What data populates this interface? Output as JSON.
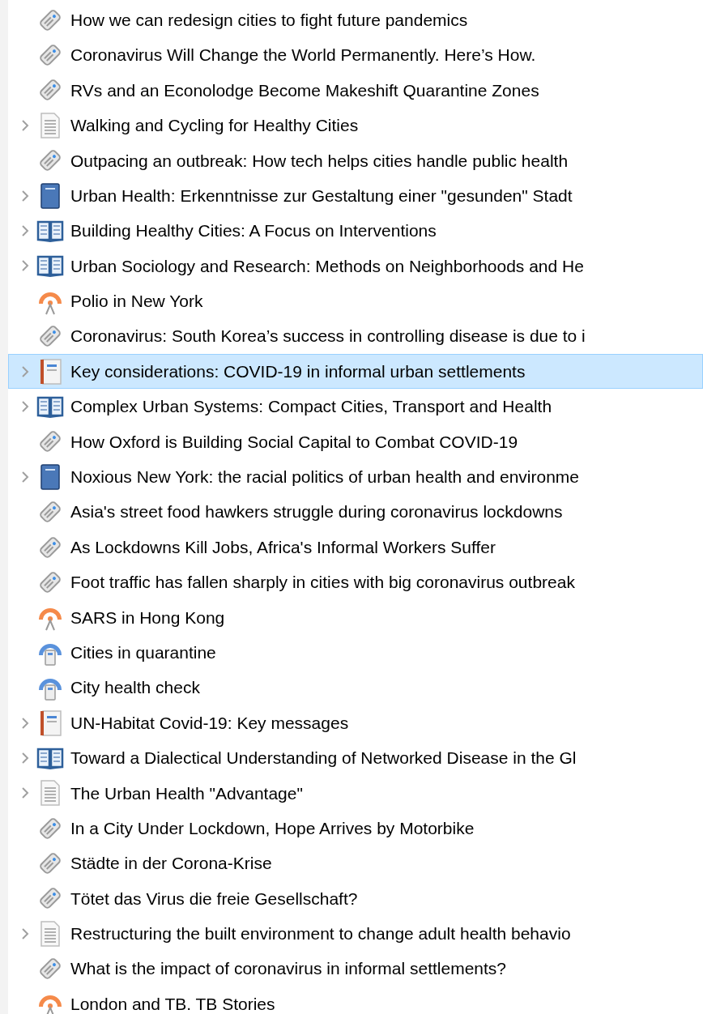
{
  "items": [
    {
      "kind": "webpage",
      "title": "How we can redesign cities to fight future pandemics",
      "expandable": false,
      "selected": false
    },
    {
      "kind": "webpage",
      "title": "Coronavirus Will Change the World Permanently. Here’s How.",
      "expandable": false,
      "selected": false
    },
    {
      "kind": "webpage",
      "title": "RVs and an Econolodge Become Makeshift Quarantine Zones",
      "expandable": false,
      "selected": false
    },
    {
      "kind": "document",
      "title": "Walking and Cycling for Healthy Cities",
      "expandable": true,
      "selected": false
    },
    {
      "kind": "webpage",
      "title": "Outpacing an outbreak: How tech helps cities handle public health",
      "expandable": false,
      "selected": false
    },
    {
      "kind": "book",
      "title": "Urban Health: Erkenntnisse zur Gestaltung einer \"gesunden\" Stadt",
      "expandable": true,
      "selected": false
    },
    {
      "kind": "section",
      "title": "Building Healthy Cities: A Focus on Interventions",
      "expandable": true,
      "selected": false
    },
    {
      "kind": "section",
      "title": "Urban Sociology and Research: Methods on Neighborhoods and He",
      "expandable": true,
      "selected": false
    },
    {
      "kind": "podcast",
      "title": "Polio in New York",
      "expandable": false,
      "selected": false
    },
    {
      "kind": "webpage",
      "title": "Coronavirus: South Korea’s success in controlling disease is due to i",
      "expandable": false,
      "selected": false
    },
    {
      "kind": "report",
      "title": "Key considerations: COVID-19 in informal urban settlements",
      "expandable": true,
      "selected": true
    },
    {
      "kind": "section",
      "title": "Complex Urban Systems: Compact Cities, Transport and Health",
      "expandable": true,
      "selected": false
    },
    {
      "kind": "webpage",
      "title": "How Oxford is Building Social Capital to Combat COVID-19",
      "expandable": false,
      "selected": false
    },
    {
      "kind": "book",
      "title": "Noxious New York: the racial politics of urban health and environme",
      "expandable": true,
      "selected": false
    },
    {
      "kind": "webpage",
      "title": "Asia's street food hawkers struggle during coronavirus lockdowns",
      "expandable": false,
      "selected": false
    },
    {
      "kind": "webpage",
      "title": "As Lockdowns Kill Jobs, Africa's Informal Workers Suffer",
      "expandable": false,
      "selected": false
    },
    {
      "kind": "webpage",
      "title": "Foot traffic has fallen sharply in cities with big coronavirus outbreak",
      "expandable": false,
      "selected": false
    },
    {
      "kind": "podcast",
      "title": "SARS in Hong Kong",
      "expandable": false,
      "selected": false
    },
    {
      "kind": "radio",
      "title": "Cities in quarantine",
      "expandable": false,
      "selected": false
    },
    {
      "kind": "radio",
      "title": "City health check",
      "expandable": false,
      "selected": false
    },
    {
      "kind": "report",
      "title": "UN-Habitat Covid-19: Key messages",
      "expandable": true,
      "selected": false
    },
    {
      "kind": "section",
      "title": "Toward a Dialectical Understanding of Networked Disease in the Gl",
      "expandable": true,
      "selected": false
    },
    {
      "kind": "document",
      "title": "The Urban Health \"Advantage\"",
      "expandable": true,
      "selected": false
    },
    {
      "kind": "webpage",
      "title": "In a City Under Lockdown, Hope Arrives by Motorbike",
      "expandable": false,
      "selected": false
    },
    {
      "kind": "webpage",
      "title": "Städte in der Corona-Krise",
      "expandable": false,
      "selected": false
    },
    {
      "kind": "webpage",
      "title": "Tötet das Virus die freie Gesellschaft?",
      "expandable": false,
      "selected": false
    },
    {
      "kind": "document",
      "title": "Restructuring the built environment to change adult health behavio",
      "expandable": true,
      "selected": false
    },
    {
      "kind": "webpage",
      "title": "What is the impact of coronavirus in informal settlements?",
      "expandable": false,
      "selected": false
    },
    {
      "kind": "podcast",
      "title": "London and TB. TB Stories",
      "expandable": false,
      "selected": false
    }
  ]
}
